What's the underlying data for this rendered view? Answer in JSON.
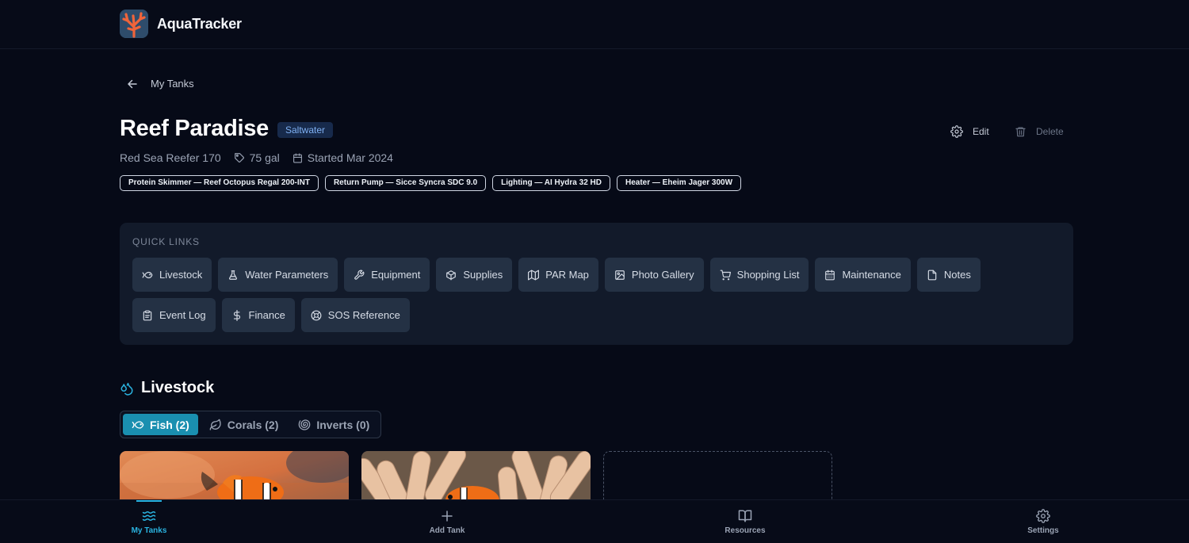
{
  "app": {
    "name": "AquaTracker"
  },
  "nav": {
    "back_label": "My Tanks"
  },
  "tank": {
    "name": "Reef Paradise",
    "type": "Saltwater",
    "model": "Red Sea Reefer 170",
    "volume": "75 gal",
    "started": "Started Mar 2024",
    "equipment": [
      "Protein Skimmer — Reef Octopus Regal 200-INT",
      "Return Pump — Sicce Syncra SDC 9.0",
      "Lighting — AI Hydra 32 HD",
      "Heater — Eheim Jager 300W"
    ]
  },
  "actions": {
    "edit_label": "Edit",
    "delete_label": "Delete"
  },
  "quick_links": {
    "label": "QUICK LINKS",
    "items": [
      {
        "label": "Livestock",
        "icon": "fish-icon"
      },
      {
        "label": "Water Parameters",
        "icon": "flask-icon"
      },
      {
        "label": "Equipment",
        "icon": "wrench-icon"
      },
      {
        "label": "Supplies",
        "icon": "package-icon"
      },
      {
        "label": "PAR Map",
        "icon": "map-icon"
      },
      {
        "label": "Photo Gallery",
        "icon": "image-icon"
      },
      {
        "label": "Shopping List",
        "icon": "cart-icon"
      },
      {
        "label": "Maintenance",
        "icon": "calendar-icon"
      },
      {
        "label": "Notes",
        "icon": "note-icon"
      },
      {
        "label": "Event Log",
        "icon": "clipboard-icon"
      },
      {
        "label": "Finance",
        "icon": "dollar-icon"
      },
      {
        "label": "SOS Reference",
        "icon": "lifebuoy-icon"
      }
    ]
  },
  "livestock": {
    "title": "Livestock",
    "tabs": [
      {
        "label": "Fish (2)",
        "icon": "fish-icon",
        "active": true
      },
      {
        "label": "Corals (2)",
        "icon": "leaf-icon",
        "active": false
      },
      {
        "label": "Inverts (0)",
        "icon": "shell-icon",
        "active": false
      }
    ]
  },
  "bottom_nav": {
    "items": [
      {
        "label": "My Tanks",
        "icon": "waves-icon",
        "active": true
      },
      {
        "label": "Add Tank",
        "icon": "plus-icon",
        "active": false
      },
      {
        "label": "Resources",
        "icon": "book-icon",
        "active": false
      },
      {
        "label": "Settings",
        "icon": "gear-icon",
        "active": false
      }
    ]
  },
  "colors": {
    "accent": "#1a8fb0",
    "nav_active": "#2ab3e0",
    "background": "#060a17",
    "panel": "#121a2a",
    "badge_bg": "#172a4b",
    "badge_text": "#7fb0f2"
  }
}
